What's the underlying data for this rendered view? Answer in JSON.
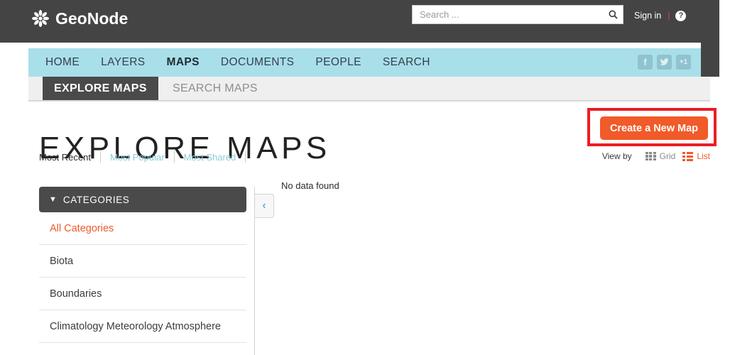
{
  "header": {
    "brand": "GeoNode",
    "logo_icon": "geonode-asterisk-logo",
    "search": {
      "placeholder": "Search ...",
      "value": "",
      "icon": "search-icon"
    },
    "signin_label": "Sign in",
    "separator": "|",
    "help_icon_label": "?"
  },
  "nav": {
    "items": [
      {
        "label": "HOME",
        "active": false
      },
      {
        "label": "LAYERS",
        "active": false
      },
      {
        "label": "MAPS",
        "active": true
      },
      {
        "label": "DOCUMENTS",
        "active": false
      },
      {
        "label": "PEOPLE",
        "active": false
      },
      {
        "label": "SEARCH",
        "active": false
      }
    ],
    "social": [
      {
        "name": "facebook-icon",
        "glyph": "f"
      },
      {
        "name": "twitter-icon",
        "glyph": "t"
      },
      {
        "name": "google-plus-one-icon",
        "glyph": "+1"
      }
    ]
  },
  "tabs": [
    {
      "label": "EXPLORE MAPS",
      "active": true
    },
    {
      "label": "SEARCH MAPS",
      "active": false
    }
  ],
  "page": {
    "title": "EXPLORE MAPS"
  },
  "sort": {
    "links": [
      {
        "label": "Most Recent",
        "active": true
      },
      {
        "label": "Most Popular",
        "active": false
      },
      {
        "label": "Most Shared",
        "active": false
      }
    ]
  },
  "actions": {
    "create_map_label": "Create a New Map",
    "highlight_color": "#ed1c24",
    "button_color": "#f15a29"
  },
  "viewby": {
    "label": "View by",
    "options": [
      {
        "label": "Grid",
        "icon": "grid-view-icon",
        "active": false
      },
      {
        "label": "List",
        "icon": "list-view-icon",
        "active": true
      }
    ]
  },
  "sidebar": {
    "header_title": "CATEGORIES",
    "header_icon": "chevron-down-icon",
    "items": [
      {
        "label": "All Categories",
        "selected": true
      },
      {
        "label": "Biota",
        "selected": false
      },
      {
        "label": "Boundaries",
        "selected": false
      },
      {
        "label": "Climatology Meteorology Atmosphere",
        "selected": false
      }
    ]
  },
  "content": {
    "empty_message": "No data found",
    "collapse_icon": "chevron-left-icon",
    "collapse_glyph": "‹"
  }
}
